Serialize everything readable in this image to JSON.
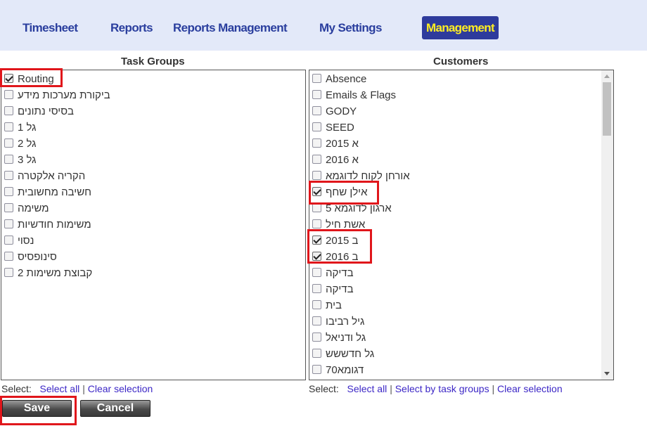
{
  "nav": {
    "items": [
      "Timesheet",
      "Reports",
      "Reports Management",
      "My Settings"
    ],
    "active": "Management",
    "active_color": "#ffee22",
    "active_bg": "#2e3b9c"
  },
  "task_groups": {
    "header": "Task Groups",
    "items": [
      {
        "label": "Routing",
        "checked": true
      },
      {
        "label": "ביקורת מערכות מידע",
        "checked": false
      },
      {
        "label": "בסיסי נתונים",
        "checked": false
      },
      {
        "label": "גל 1",
        "checked": false
      },
      {
        "label": "גל 2",
        "checked": false
      },
      {
        "label": "גל 3",
        "checked": false
      },
      {
        "label": "הקריה אלקטרה",
        "checked": false
      },
      {
        "label": "חשיבה מחשובית",
        "checked": false
      },
      {
        "label": "משימה",
        "checked": false
      },
      {
        "label": "משימות חודשיות",
        "checked": false
      },
      {
        "label": "נסוי",
        "checked": false
      },
      {
        "label": "סינופסיס",
        "checked": false
      },
      {
        "label": "קבוצת משימות 2",
        "checked": false
      }
    ],
    "select_label": "Select:",
    "select_all": "Select all",
    "clear_selection": "Clear selection"
  },
  "customers": {
    "header": "Customers",
    "items": [
      {
        "label": "Absence",
        "checked": false
      },
      {
        "label": "Emails & Flags",
        "checked": false
      },
      {
        "label": "GODY",
        "checked": false
      },
      {
        "label": "SEED",
        "checked": false
      },
      {
        "label": "א 2015",
        "checked": false
      },
      {
        "label": "א 2016",
        "checked": false
      },
      {
        "label": "אורחן לקוח לדוגמא",
        "checked": false
      },
      {
        "label": "אילן שחף",
        "checked": true
      },
      {
        "label": "ארגון לדוגמא 5",
        "checked": false
      },
      {
        "label": "אשת חיל",
        "checked": false
      },
      {
        "label": "ב 2015",
        "checked": true
      },
      {
        "label": "ב 2016",
        "checked": true
      },
      {
        "label": "בדיקה",
        "checked": false
      },
      {
        "label": "בדיקה",
        "checked": false
      },
      {
        "label": "בית",
        "checked": false
      },
      {
        "label": "גיל רביבו",
        "checked": false
      },
      {
        "label": "גל ודניאל",
        "checked": false
      },
      {
        "label": "גל חדששש",
        "checked": false
      },
      {
        "label": "דגומא70",
        "checked": false
      }
    ],
    "select_label": "Select:",
    "select_all": "Select all",
    "select_by_task_groups": "Select by task groups",
    "clear_selection": "Clear selection"
  },
  "buttons": {
    "save": "Save",
    "cancel": "Cancel"
  },
  "highlight_color": "#e0161b"
}
